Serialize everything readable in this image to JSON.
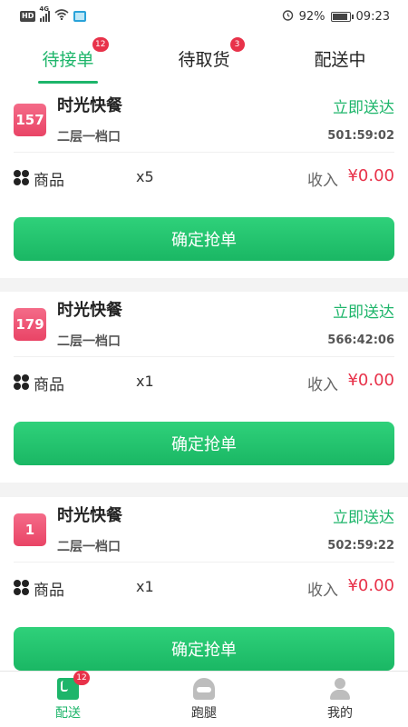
{
  "status_bar": {
    "network_badge": "HD",
    "network_type": "4G",
    "battery": "92%",
    "time": "09:23"
  },
  "tabs": [
    {
      "label": "待接单",
      "badge": "12",
      "active": true
    },
    {
      "label": "待取货",
      "badge": "3",
      "active": false
    },
    {
      "label": "配送中",
      "badge": "",
      "active": false
    }
  ],
  "orders": [
    {
      "number": "157",
      "shop_name": "时光快餐",
      "action": "立即送达",
      "address": "二层一档口",
      "countdown": "501:59:02",
      "goods_label": "商品",
      "quantity": "x5",
      "income_label": "收入",
      "income_value": "¥0.00",
      "button_label": "确定抢单"
    },
    {
      "number": "179",
      "shop_name": "时光快餐",
      "action": "立即送达",
      "address": "二层一档口",
      "countdown": "566:42:06",
      "goods_label": "商品",
      "quantity": "x1",
      "income_label": "收入",
      "income_value": "¥0.00",
      "button_label": "确定抢单"
    },
    {
      "number": "1",
      "shop_name": "时光快餐",
      "action": "立即送达",
      "address": "二层一档口",
      "countdown": "502:59:22",
      "goods_label": "商品",
      "quantity": "x1",
      "income_label": "收入",
      "income_value": "¥0.00",
      "button_label": "确定抢单"
    }
  ],
  "bottom_nav": [
    {
      "label": "配送",
      "icon": "delivery-icon",
      "badge": "12",
      "active": true
    },
    {
      "label": "跑腿",
      "icon": "helmet-icon",
      "badge": "",
      "active": false
    },
    {
      "label": "我的",
      "icon": "user-icon",
      "badge": "",
      "active": false
    }
  ],
  "colors": {
    "accent": "#1db56a",
    "badge": "#e8324a",
    "number_box": "#ef5577"
  }
}
